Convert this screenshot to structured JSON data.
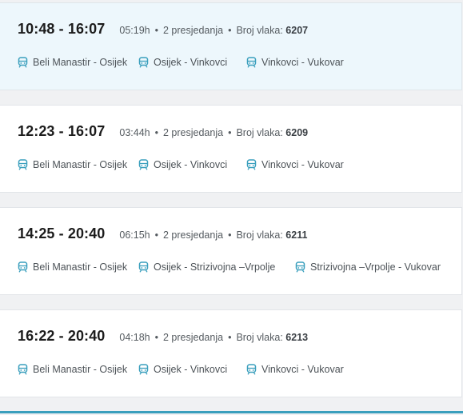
{
  "separator": "•",
  "trips": [
    {
      "times": "10:48 - 16:07",
      "duration": "05:19h",
      "transfers": "2 presjedanja",
      "train_label": "Broj vlaka:",
      "train_number": "6207",
      "segments": [
        "Beli Manastir - Osijek",
        "Osijek - Vinkovci",
        "Vinkovci - Vukovar"
      ]
    },
    {
      "times": "12:23 - 16:07",
      "duration": "03:44h",
      "transfers": "2 presjedanja",
      "train_label": "Broj vlaka:",
      "train_number": "6209",
      "segments": [
        "Beli Manastir - Osijek",
        "Osijek - Vinkovci",
        "Vinkovci - Vukovar"
      ]
    },
    {
      "times": "14:25 - 20:40",
      "duration": "06:15h",
      "transfers": "2 presjedanja",
      "train_label": "Broj vlaka:",
      "train_number": "6211",
      "segments": [
        "Beli Manastir - Osijek",
        "Osijek - Strizivojna –Vrpolje",
        "Strizivojna –Vrpolje - Vukovar"
      ]
    },
    {
      "times": "16:22 - 20:40",
      "duration": "04:18h",
      "transfers": "2 presjedanja",
      "train_label": "Broj vlaka:",
      "train_number": "6213",
      "segments": [
        "Beli Manastir - Osijek",
        "Osijek - Vinkovci",
        "Vinkovci - Vukovar"
      ]
    }
  ],
  "icons": {
    "segment_icon": "train-icon"
  },
  "colors": {
    "accent": "#3a9fbd",
    "selected_bg": "#edf7fc",
    "icon": "#3a9fbd"
  }
}
